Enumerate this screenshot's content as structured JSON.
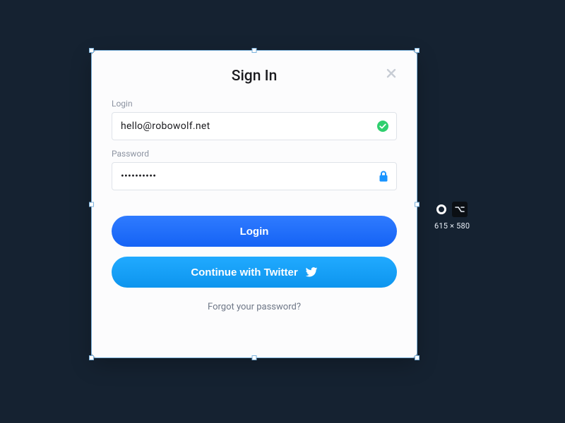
{
  "dialog": {
    "title": "Sign In",
    "login_label": "Login",
    "login_value": "hello@robowolf.net",
    "password_label": "Password",
    "password_value": "••••••••••",
    "login_button": "Login",
    "twitter_button": "Continue with Twitter",
    "forgot": "Forgot your password?"
  },
  "editor": {
    "dimensions": "615 × 580"
  },
  "colors": {
    "bg": "#152231",
    "card": "#fcfcfd",
    "primary_start": "#2f7bff",
    "primary_end": "#1563f5",
    "twitter_start": "#21aaff",
    "twitter_end": "#0d95ee",
    "valid": "#2fcf6e",
    "lock": "#1894ff"
  }
}
